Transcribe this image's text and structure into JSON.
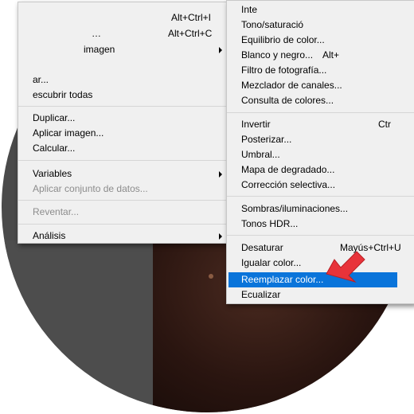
{
  "left_menu": {
    "items": [
      {
        "label": "…",
        "shortcut": "Alt+Ctrl+I",
        "disabled": false
      },
      {
        "label": "…",
        "shortcut": "Alt+Ctrl+C",
        "disabled": false
      },
      {
        "label": "imagen",
        "shortcut": "",
        "disabled": false
      },
      {
        "label": "ar...",
        "shortcut": "",
        "disabled": false
      },
      {
        "label": "escubrir todas",
        "shortcut": "",
        "disabled": false
      },
      {
        "label": "Duplicar...",
        "shortcut": "",
        "disabled": false
      },
      {
        "label": "Aplicar imagen...",
        "shortcut": "",
        "disabled": false
      },
      {
        "label": "Calcular...",
        "shortcut": "",
        "disabled": false
      },
      {
        "label": "Variables",
        "shortcut": "",
        "disabled": false
      },
      {
        "label": "Aplicar conjunto de datos...",
        "shortcut": "",
        "disabled": true
      },
      {
        "label": "Reventar...",
        "shortcut": "",
        "disabled": true
      },
      {
        "label": "Análisis",
        "shortcut": "",
        "disabled": false
      }
    ]
  },
  "right_menu": {
    "items": [
      {
        "label": "Inte",
        "shortcut": ""
      },
      {
        "label": "Tono/saturació",
        "shortcut": ""
      },
      {
        "label": "Equilibrio de color...",
        "shortcut": ""
      },
      {
        "label": "Blanco y negro...",
        "shortcut": "Alt+"
      },
      {
        "label": "Filtro de fotografía...",
        "shortcut": ""
      },
      {
        "label": "Mezclador de canales...",
        "shortcut": ""
      },
      {
        "label": "Consulta de colores...",
        "shortcut": ""
      },
      {
        "label": "Invertir",
        "shortcut": "Ctr"
      },
      {
        "label": "Posterizar...",
        "shortcut": ""
      },
      {
        "label": "Umbral...",
        "shortcut": ""
      },
      {
        "label": "Mapa de degradado...",
        "shortcut": ""
      },
      {
        "label": "Corrección selectiva...",
        "shortcut": ""
      },
      {
        "label": "Sombras/iluminaciones...",
        "shortcut": ""
      },
      {
        "label": "Tonos HDR...",
        "shortcut": ""
      },
      {
        "label": "Desaturar",
        "shortcut": "Mayús+Ctrl+U"
      },
      {
        "label": "Igualar color...",
        "shortcut": ""
      },
      {
        "label": "Reemplazar color...",
        "shortcut": ""
      },
      {
        "label": "Ecualizar",
        "shortcut": ""
      }
    ],
    "highlighted": "Reemplazar color..."
  },
  "colors": {
    "highlight": "#0a74da",
    "pointer": "#e8333a"
  }
}
